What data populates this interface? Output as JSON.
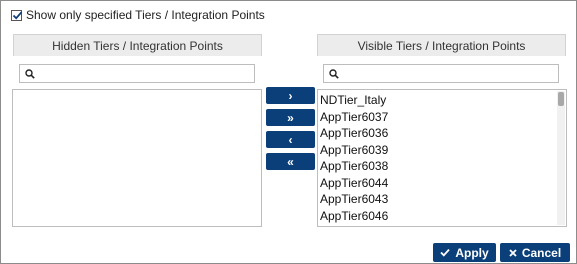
{
  "filter": {
    "label": "Show only specified Tiers / Integration Points",
    "checked": true
  },
  "hidden_panel": {
    "title": "Hidden Tiers / Integration Points",
    "search_value": "",
    "items": []
  },
  "visible_panel": {
    "title": "Visible Tiers / Integration Points",
    "search_value": "",
    "items": [
      "NDTier_Italy",
      "AppTier6037",
      "AppTier6036",
      "AppTier6039",
      "AppTier6038",
      "AppTier6044",
      "AppTier6043",
      "AppTier6046"
    ]
  },
  "move_buttons": {
    "move_right": "›",
    "move_all_right": "»",
    "move_left": "‹",
    "move_all_left": "«"
  },
  "footer": {
    "apply_label": "Apply",
    "cancel_label": "Cancel"
  },
  "colors": {
    "button_bg": "#0b3f7a",
    "header_bg": "#ececec"
  },
  "icons": {
    "check": "check-icon",
    "search": "search-icon",
    "cancel": "x-icon"
  }
}
